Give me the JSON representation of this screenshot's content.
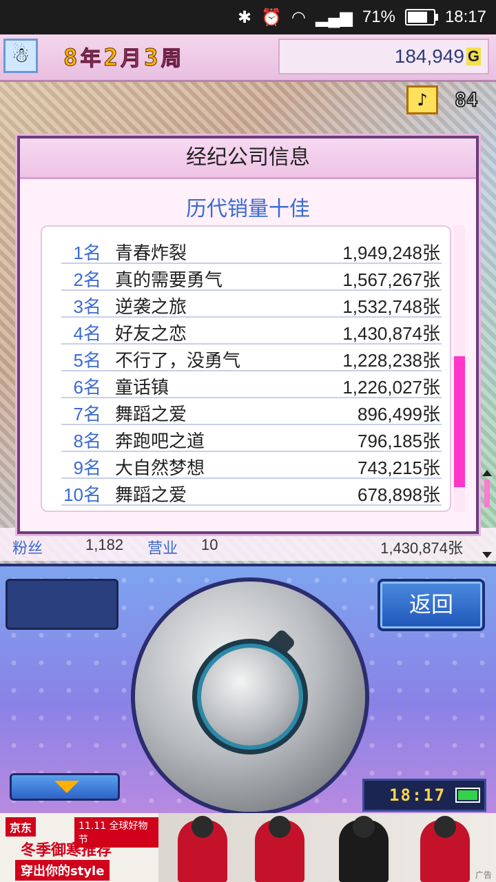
{
  "status_bar": {
    "battery": "71%",
    "time": "18:17"
  },
  "top_bar": {
    "date": {
      "year": "8",
      "year_unit": "年",
      "month": "2",
      "month_unit": "月",
      "week": "3",
      "week_unit": "周"
    },
    "money": "184,949",
    "currency": "G"
  },
  "scene": {
    "fans_level": "84"
  },
  "info_row": {
    "fans_label": "粉丝",
    "fans_value": "1,182",
    "business_label": "营业",
    "business_value": "10",
    "sales_value": "1,430,874张"
  },
  "dialog": {
    "title": "经纪公司信息",
    "subtitle": "历代销量十佳",
    "rankings": [
      {
        "rank": "1名",
        "title": "青春炸裂",
        "sales": "1,949,248张"
      },
      {
        "rank": "2名",
        "title": "真的需要勇气",
        "sales": "1,567,267张"
      },
      {
        "rank": "3名",
        "title": "逆袭之旅",
        "sales": "1,532,748张"
      },
      {
        "rank": "4名",
        "title": "好友之恋",
        "sales": "1,430,874张"
      },
      {
        "rank": "5名",
        "title": "不行了，没勇气",
        "sales": "1,228,238张"
      },
      {
        "rank": "6名",
        "title": "童话镇",
        "sales": "1,226,027张"
      },
      {
        "rank": "7名",
        "title": "舞蹈之爱",
        "sales": "896,499张"
      },
      {
        "rank": "8名",
        "title": "奔跑吧之道",
        "sales": "796,185张"
      },
      {
        "rank": "9名",
        "title": "大自然梦想",
        "sales": "743,215张"
      },
      {
        "rank": "10名",
        "title": "舞蹈之爱",
        "sales": "678,898张"
      }
    ]
  },
  "controls": {
    "back_label": "返回",
    "clock": "18:17"
  },
  "ad": {
    "brand": "京东",
    "event": "11.11 全球好物节",
    "line1": "冬季御寒推荐",
    "line2": "穿出你的style",
    "mark": "广告"
  },
  "colors": {
    "accent_blue": "#3a6bd0",
    "scroll_thumb": "#ff36c8",
    "dialog_border": "#6b3d7a"
  }
}
